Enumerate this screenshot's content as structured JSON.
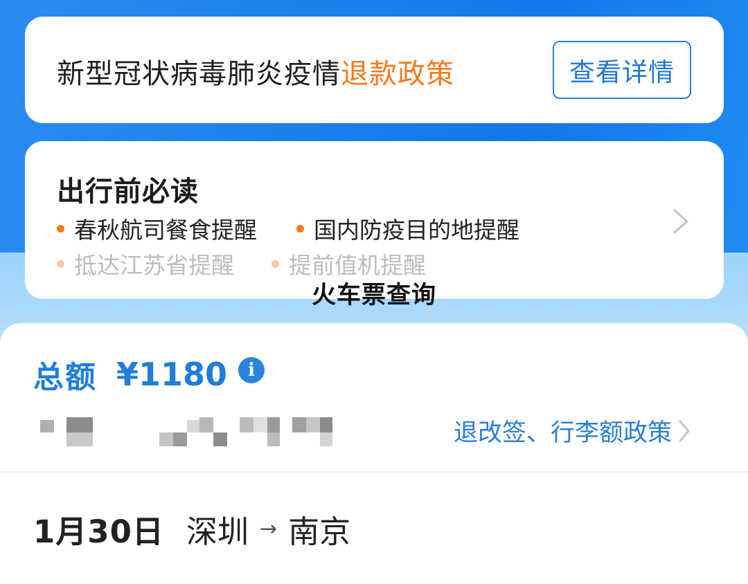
{
  "notice": {
    "text_main": "新型冠状病毒肺炎疫情",
    "text_highlight": "退款政策",
    "button_label": "查看详情"
  },
  "travel": {
    "title": "出行前必读",
    "tips": [
      "春秋航司餐食提醒",
      "国内防疫目的地提醒",
      "抵达江苏省提醒",
      "提前值机提醒"
    ],
    "chevron_icon": "chevron-right-icon"
  },
  "overlay_title": "火车票查询",
  "order": {
    "total_label": "总额",
    "total_amount": "¥1180",
    "info_icon": "info-icon",
    "policy_link": "退改签、行李额政策",
    "date": "1月30日",
    "from": "深圳",
    "arrow": "→",
    "to": "南京"
  },
  "colors": {
    "brand_blue": "#1a7fec",
    "accent_orange": "#f47a1c",
    "link_blue": "#2a7fd4"
  }
}
